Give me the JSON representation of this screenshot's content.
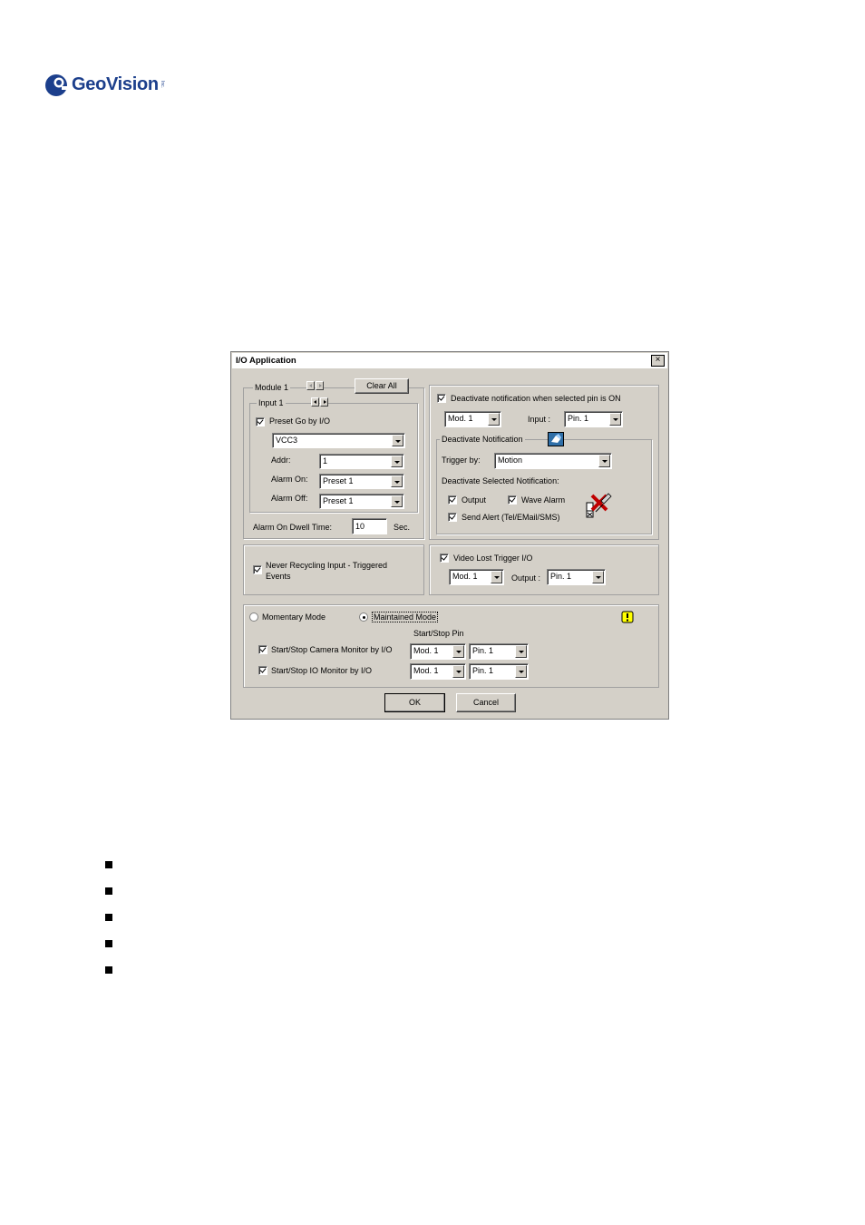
{
  "logo": {
    "text": "GeoVision",
    "sub": "Inc."
  },
  "dialog": {
    "title": "I/O Application",
    "close": "×",
    "module": {
      "label": "Module 1",
      "clear_all": "Clear All"
    },
    "input": {
      "label": "Input 1",
      "preset_go": {
        "label": "Preset Go by I/O",
        "checked": true
      },
      "camera": "VCC3",
      "addr_label": "Addr:",
      "addr": "1",
      "alarm_on_label": "Alarm On:",
      "alarm_on": "Preset 1",
      "alarm_off_label": "Alarm Off:",
      "alarm_off": "Preset 1"
    },
    "dwell": {
      "label": "Alarm On Dwell Time:",
      "value": "10",
      "unit": "Sec."
    },
    "deactivate": {
      "label": "Deactivate notification when selected pin is ON",
      "checked": true,
      "module": "Mod. 1",
      "input_label": "Input :",
      "pin": "Pin. 1",
      "group_label": "Deactivate Notification",
      "trigger_label": "Trigger by:",
      "trigger": "Motion",
      "selected_label": "Deactivate Selected Notification:",
      "output": "Output",
      "wave_alarm": "Wave Alarm",
      "send_alert": "Send Alert (Tel/EMail/SMS)"
    },
    "never_recycling": "Never Recycling Input - Triggered Events",
    "video_lost": {
      "label": "Video Lost Trigger I/O",
      "module": "Mod. 1",
      "output_label": "Output :",
      "pin": "Pin. 1"
    },
    "mode": {
      "momentary": "Momentary Mode",
      "maintained": "Maintained Mode",
      "selected": "Maintained Mode",
      "start_stop_pin": "Start/Stop Pin",
      "camera_monitor": {
        "label": "Start/Stop Camera Monitor by I/O",
        "module": "Mod. 1",
        "pin": "Pin. 1"
      },
      "io_monitor": {
        "label": "Start/Stop IO Monitor by I/O",
        "module": "Mod. 1",
        "pin": "Pin. 1"
      }
    },
    "ok": "OK",
    "cancel": "Cancel"
  },
  "bullets": [
    "",
    "",
    "",
    "",
    ""
  ]
}
